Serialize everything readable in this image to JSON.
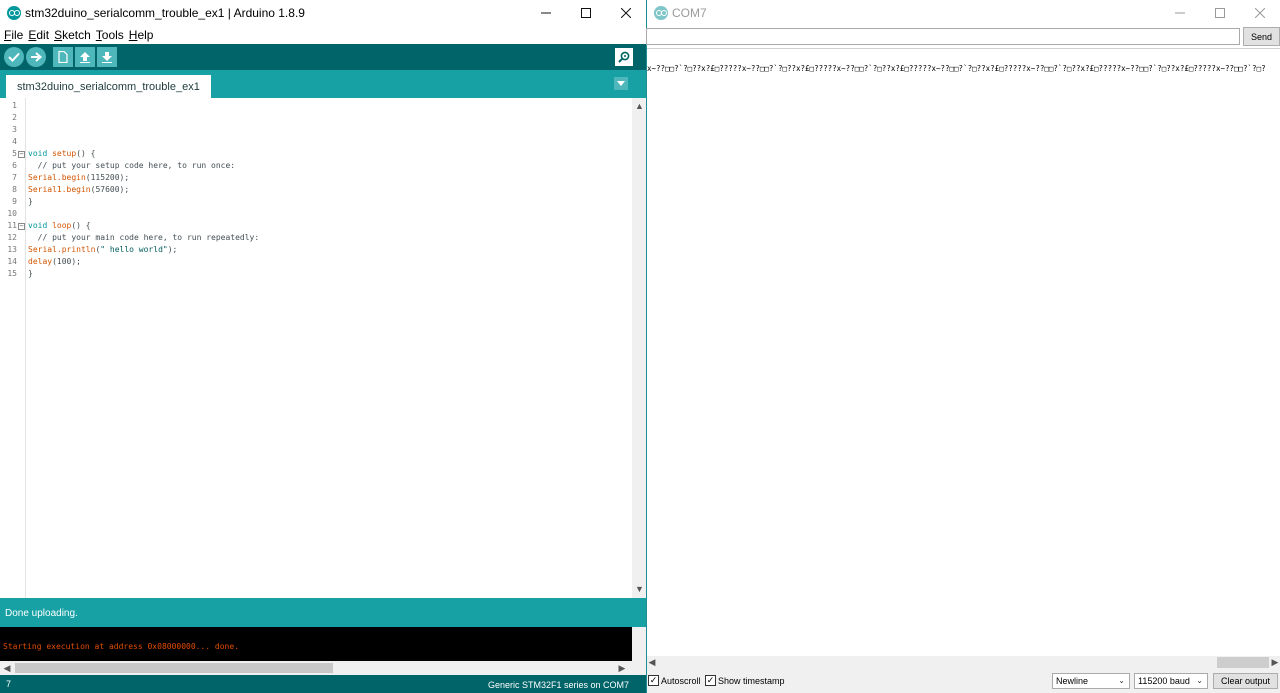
{
  "ide": {
    "title": "stm32duino_serialcomm_trouble_ex1 | Arduino 1.8.9",
    "menu": [
      {
        "underline": "F",
        "rest": "ile"
      },
      {
        "underline": "E",
        "rest": "dit"
      },
      {
        "underline": "S",
        "rest": "ketch"
      },
      {
        "underline": "T",
        "rest": "ools"
      },
      {
        "underline": "H",
        "rest": "elp"
      }
    ],
    "toolbar_icons": [
      "verify-icon",
      "upload-icon",
      "new-icon",
      "open-icon",
      "save-icon",
      "serial-monitor-icon"
    ],
    "tab_label": "stm32duino_serialcomm_trouble_ex1",
    "line_numbers": [
      "1",
      "2",
      "3",
      "4",
      "5",
      "6",
      "7",
      "8",
      "9",
      "10",
      "11",
      "12",
      "13",
      "14",
      "15"
    ],
    "code": {
      "l5_kw": "void",
      "l5_fn": "setup",
      "l5_rest": "() {",
      "l6": "  // put your setup code here, to run once:",
      "l7_fn": "Serial.begin",
      "l7_rest": "(115200);",
      "l8_fn": "Serial1.begin",
      "l8_rest": "(57600);",
      "l9": "}",
      "l11_kw": "void",
      "l11_fn": "loop",
      "l11_rest": "() {",
      "l12": "  // put your main code here, to run repeatedly:",
      "l13_fn": "Serial.println",
      "l13_open": "(",
      "l13_str": "\" hello world\"",
      "l13_close": ");",
      "l14_fn": "delay",
      "l14_rest": "(100);",
      "l15": "}"
    },
    "status": "Done uploading.",
    "console": "Starting execution at address 0x08000000... done.",
    "footer_line": "7",
    "footer_board": "Generic STM32F1 series on COM7"
  },
  "serial": {
    "title": "COM7",
    "send_label": "Send",
    "input_value": "",
    "output": "x~??□□?`?□??x?£□?????x~??□□?`?□??x?£□?????x~??□□?`?□??x?£□?????x~??□□?`?□??x?£□?????x~??□□?`?□??x?£□?????x~??□□?`?□??x?£□?????x~??□□?`?□?",
    "autoscroll_label": "Autoscroll",
    "autoscroll_checked": true,
    "timestamp_label": "Show timestamp",
    "timestamp_checked": true,
    "line_ending": "Newline",
    "baud": "115200 baud",
    "clear_label": "Clear output"
  },
  "colors": {
    "teal_dark": "#006468",
    "teal": "#17a1a5",
    "teal_light": "#4db7bb",
    "console_text": "#e34c00"
  }
}
